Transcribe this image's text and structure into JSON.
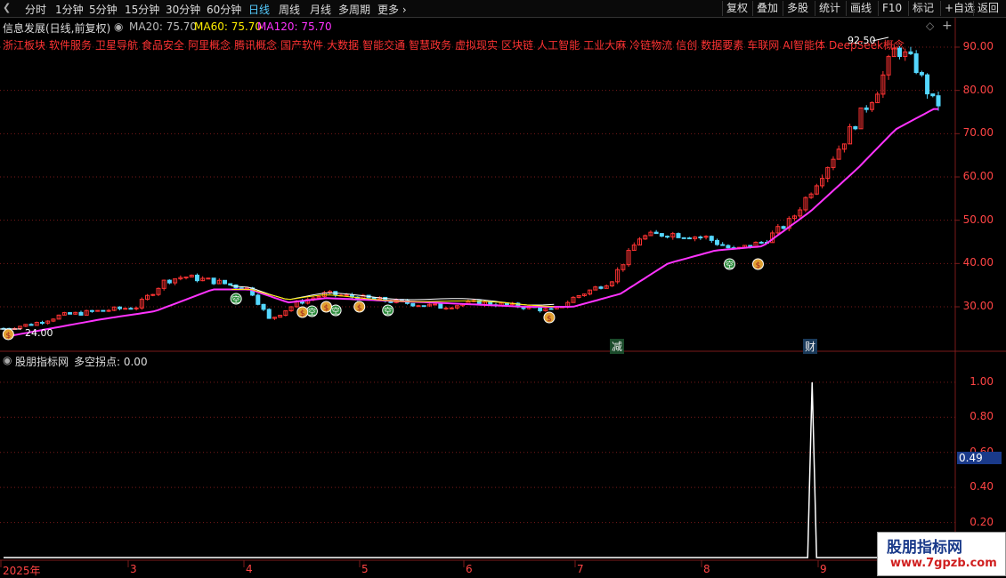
{
  "toolbar": {
    "left_items": [
      "分时",
      "1分钟",
      "5分钟",
      "15分钟",
      "30分钟",
      "60分钟",
      "日线",
      "周线",
      "月线",
      "多周期",
      "更多"
    ],
    "active": "日线",
    "right_items": [
      "复权",
      "叠加",
      "多股",
      "统计",
      "画线",
      "F10",
      "标记",
      "+自选",
      "返回"
    ]
  },
  "main_header": {
    "title": "信息发展(日线,前复权)",
    "ma20_label": "MA20: 75.70",
    "ma60_label": "MA60: 75.70",
    "ma120_label": "MA120: 75.70"
  },
  "concepts": [
    "浙江板块",
    "软件服务",
    "卫星导航",
    "食品安全",
    "阿里概念",
    "腾讯概念",
    "国产软件",
    "大数据",
    "智能交通",
    "智慧政务",
    "虚拟现实",
    "区块链",
    "人工智能",
    "工业大麻",
    "冷链物流",
    "信创",
    "数据要素",
    "车联网",
    "AI智能体",
    "DeepSeek概念"
  ],
  "annotations": {
    "high_label": "92.50",
    "low_label": "24.00",
    "tag_jian": "减",
    "tag_cai": "财",
    "marker_kong": "空",
    "marker_money": "$"
  },
  "main_yaxis": [
    "90.00",
    "80.00",
    "70.00",
    "60.00",
    "50.00",
    "40.00",
    "30.00"
  ],
  "indicator_header": {
    "title": "股朋指标网",
    "label": "多空拐点: 0.00"
  },
  "indicator_yaxis": [
    "1.00",
    "0.80",
    "0.60",
    "0.40",
    "0.20"
  ],
  "indicator_current": "0.49",
  "dates": [
    "2025年",
    "3",
    "4",
    "5",
    "6",
    "7",
    "8",
    "9"
  ],
  "watermark": {
    "line1": "股朋指标网",
    "line2": "www.7gpzb.com"
  },
  "colors": {
    "up": "#ff3333",
    "down": "#54d7ff",
    "ma20": "#ffffff",
    "ma60": "#ffee00",
    "ma120": "#ff33ff",
    "kong": "#2a8a3a",
    "grid": "#7a1a1a"
  },
  "chart_data": {
    "type": "candlestick",
    "ylim": [
      22,
      95
    ],
    "price_points": [
      {
        "x": 0.0,
        "close": 25
      },
      {
        "x": 0.03,
        "close": 26
      },
      {
        "x": 0.06,
        "close": 28
      },
      {
        "x": 0.1,
        "close": 29
      },
      {
        "x": 0.14,
        "close": 30
      },
      {
        "x": 0.17,
        "close": 36
      },
      {
        "x": 0.19,
        "close": 37
      },
      {
        "x": 0.22,
        "close": 36
      },
      {
        "x": 0.26,
        "close": 34
      },
      {
        "x": 0.28,
        "close": 27
      },
      {
        "x": 0.31,
        "close": 31
      },
      {
        "x": 0.34,
        "close": 33
      },
      {
        "x": 0.38,
        "close": 32
      },
      {
        "x": 0.42,
        "close": 31
      },
      {
        "x": 0.46,
        "close": 30
      },
      {
        "x": 0.5,
        "close": 31
      },
      {
        "x": 0.55,
        "close": 30
      },
      {
        "x": 0.58,
        "close": 29
      },
      {
        "x": 0.6,
        "close": 32
      },
      {
        "x": 0.64,
        "close": 36
      },
      {
        "x": 0.67,
        "close": 46
      },
      {
        "x": 0.7,
        "close": 47
      },
      {
        "x": 0.74,
        "close": 46
      },
      {
        "x": 0.77,
        "close": 43
      },
      {
        "x": 0.8,
        "close": 45
      },
      {
        "x": 0.83,
        "close": 50
      },
      {
        "x": 0.86,
        "close": 60
      },
      {
        "x": 0.89,
        "close": 70
      },
      {
        "x": 0.92,
        "close": 80
      },
      {
        "x": 0.94,
        "close": 90
      },
      {
        "x": 0.96,
        "close": 86
      },
      {
        "x": 0.98,
        "close": 77
      }
    ],
    "ma120": [
      {
        "x": 0.0,
        "v": 23
      },
      {
        "x": 0.1,
        "v": 27
      },
      {
        "x": 0.16,
        "v": 29
      },
      {
        "x": 0.22,
        "v": 34
      },
      {
        "x": 0.26,
        "v": 34
      },
      {
        "x": 0.3,
        "v": 31
      },
      {
        "x": 0.34,
        "v": 32
      },
      {
        "x": 0.45,
        "v": 31
      },
      {
        "x": 0.55,
        "v": 30
      },
      {
        "x": 0.6,
        "v": 30
      },
      {
        "x": 0.65,
        "v": 33
      },
      {
        "x": 0.7,
        "v": 40
      },
      {
        "x": 0.75,
        "v": 43
      },
      {
        "x": 0.8,
        "v": 44
      },
      {
        "x": 0.85,
        "v": 52
      },
      {
        "x": 0.9,
        "v": 62
      },
      {
        "x": 0.94,
        "v": 71
      },
      {
        "x": 0.98,
        "v": 75.7
      }
    ],
    "indicator_series": {
      "name": "多空拐点",
      "spike_x": 0.852,
      "spike_value": 1.0,
      "baseline": 0.0
    },
    "indicator_ylim": [
      0,
      1.05
    ]
  }
}
